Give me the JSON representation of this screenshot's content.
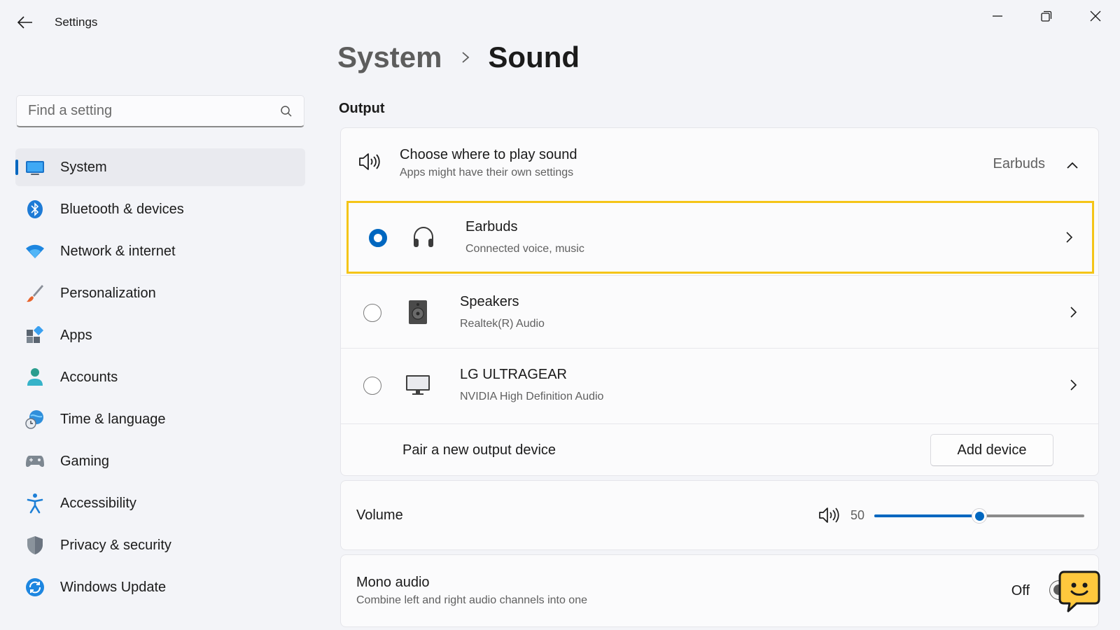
{
  "app": {
    "title": "Settings"
  },
  "search": {
    "placeholder": "Find a setting"
  },
  "sidebar": {
    "items": [
      {
        "label": "System",
        "icon": "system-icon",
        "active": true
      },
      {
        "label": "Bluetooth & devices",
        "icon": "bluetooth-icon"
      },
      {
        "label": "Network & internet",
        "icon": "wifi-icon"
      },
      {
        "label": "Personalization",
        "icon": "brush-icon"
      },
      {
        "label": "Apps",
        "icon": "apps-icon"
      },
      {
        "label": "Accounts",
        "icon": "person-icon"
      },
      {
        "label": "Time & language",
        "icon": "globe-clock-icon"
      },
      {
        "label": "Gaming",
        "icon": "controller-icon"
      },
      {
        "label": "Accessibility",
        "icon": "accessibility-icon"
      },
      {
        "label": "Privacy & security",
        "icon": "shield-icon"
      },
      {
        "label": "Windows Update",
        "icon": "update-icon"
      }
    ]
  },
  "breadcrumb": {
    "parent": "System",
    "current": "Sound"
  },
  "output": {
    "section_title": "Output",
    "header": {
      "title": "Choose where to play sound",
      "subtitle": "Apps might have their own settings",
      "value": "Earbuds"
    },
    "devices": [
      {
        "name": "Earbuds",
        "description": "Connected voice, music",
        "icon": "headphones-icon",
        "selected": true
      },
      {
        "name": "Speakers",
        "description": "Realtek(R) Audio",
        "icon": "speaker-box-icon",
        "selected": false
      },
      {
        "name": "LG ULTRAGEAR",
        "description": "NVIDIA High Definition Audio",
        "icon": "monitor-icon",
        "selected": false
      }
    ],
    "pair": {
      "label": "Pair a new output device",
      "button": "Add device"
    }
  },
  "volume": {
    "label": "Volume",
    "value": "50",
    "level": 0.5
  },
  "mono": {
    "title": "Mono audio",
    "subtitle": "Combine left and right audio channels into one",
    "state": "Off"
  },
  "colors": {
    "accent": "#0067c0",
    "highlight": "#f5c518",
    "mascot": "#ffc83d"
  }
}
